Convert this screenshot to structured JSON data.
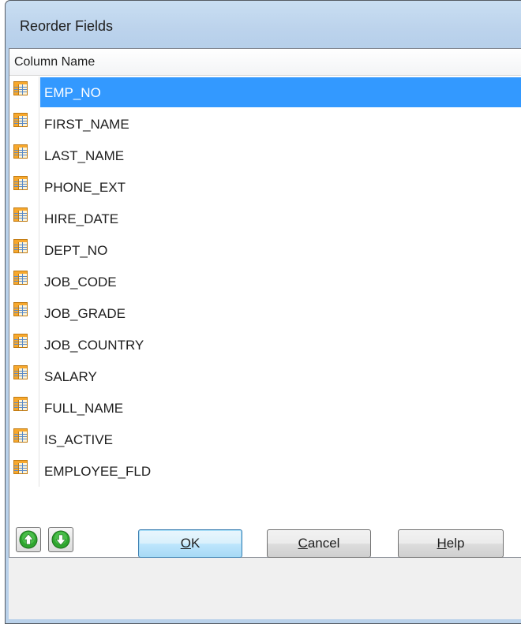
{
  "window": {
    "title": "Reorder Fields"
  },
  "grid": {
    "column_header": "Column Name",
    "selected_index": 0,
    "rows": [
      {
        "name": "EMP_NO",
        "icon": "table-field-icon"
      },
      {
        "name": "FIRST_NAME",
        "icon": "table-field-icon"
      },
      {
        "name": "LAST_NAME",
        "icon": "table-field-icon"
      },
      {
        "name": "PHONE_EXT",
        "icon": "table-field-icon"
      },
      {
        "name": "HIRE_DATE",
        "icon": "table-field-icon"
      },
      {
        "name": "DEPT_NO",
        "icon": "table-field-icon"
      },
      {
        "name": "JOB_CODE",
        "icon": "table-field-icon"
      },
      {
        "name": "JOB_GRADE",
        "icon": "table-field-icon"
      },
      {
        "name": "JOB_COUNTRY",
        "icon": "table-field-icon"
      },
      {
        "name": "SALARY",
        "icon": "table-field-icon"
      },
      {
        "name": "FULL_NAME",
        "icon": "table-field-icon"
      },
      {
        "name": "IS_ACTIVE",
        "icon": "table-field-icon"
      },
      {
        "name": "EMPLOYEE_FLD",
        "icon": "table-field-icon"
      }
    ]
  },
  "buttons": {
    "move_up_icon": "green-arrow-up-icon",
    "move_down_icon": "green-arrow-down-icon",
    "ok": {
      "mnemonic": "O",
      "rest": "K"
    },
    "cancel": {
      "mnemonic": "C",
      "rest": "ancel"
    },
    "help": {
      "mnemonic": "H",
      "rest": "elp"
    }
  },
  "colors": {
    "selection": "#3399ff",
    "titlebar": "#bcd3ec",
    "icon_orange": "#f7a82d",
    "arrow_green": "#2fa52f"
  }
}
